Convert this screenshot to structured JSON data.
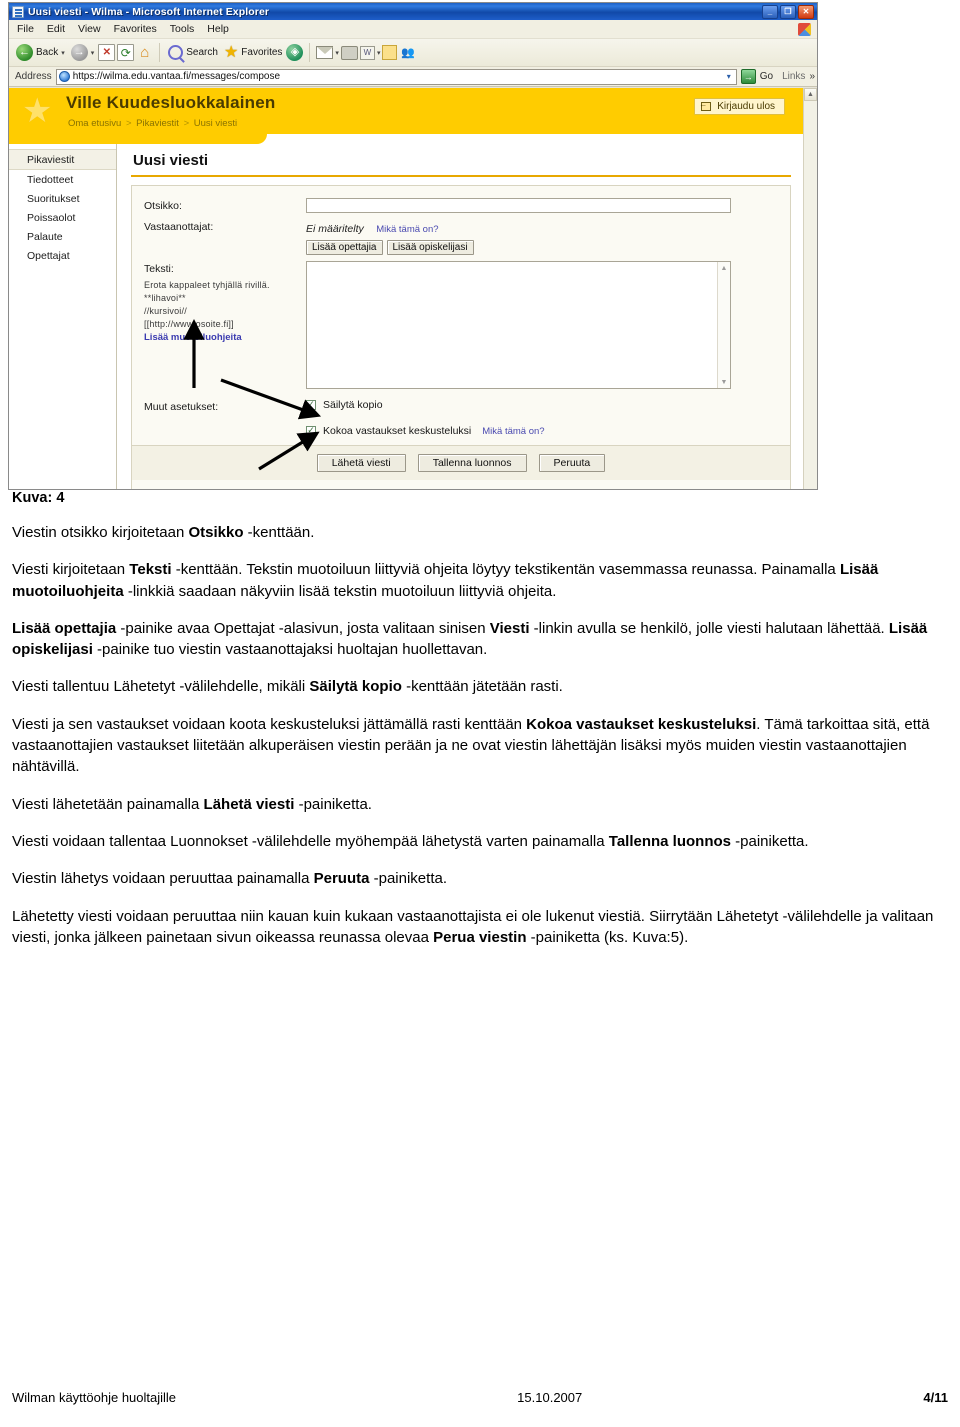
{
  "browser": {
    "title": "Uusi viesti - Wilma - Microsoft Internet Explorer",
    "window_buttons": {
      "minimize": "_",
      "maximize": "❐",
      "close": "✕"
    },
    "menu": [
      "File",
      "Edit",
      "View",
      "Favorites",
      "Tools",
      "Help"
    ],
    "toolbar": {
      "back_label": "Back",
      "back_caret": "▾",
      "forward_caret": "▾",
      "search_label": "Search",
      "favorites_label": "Favorites",
      "icons": [
        "back-arrow",
        "forward-arrow",
        "stop",
        "refresh",
        "home",
        "search",
        "favorites",
        "media",
        "mail",
        "print",
        "edit-word",
        "notes",
        "messenger"
      ]
    },
    "address": {
      "label": "Address",
      "url": "https://wilma.edu.vantaa.fi/messages/compose",
      "dropdown": "▾",
      "go_label": "Go",
      "links_label": "Links",
      "chevron": "»"
    }
  },
  "wilma": {
    "user_name": "Ville Kuudesluokkalainen",
    "breadcrumb": [
      "Oma etusivu",
      "Pikaviestit",
      "Uusi viesti"
    ],
    "breadcrumb_separator": ">",
    "logout_label": "Kirjaudu ulos",
    "sidebar": [
      {
        "label": "Pikaviestit",
        "active": true
      },
      {
        "label": "Tiedotteet",
        "active": false
      },
      {
        "label": "Suoritukset",
        "active": false
      },
      {
        "label": "Poissaolot",
        "active": false
      },
      {
        "label": "Palaute",
        "active": false
      },
      {
        "label": "Opettajat",
        "active": false
      }
    ],
    "page_title": "Uusi viesti",
    "form": {
      "subject_label": "Otsikko:",
      "subject_value": "",
      "recipients_label": "Vastaanottajat:",
      "recipients_value": "Ei määritelty",
      "recipients_help": "Mikä tämä on?",
      "add_teacher_button": "Lisää opettajia",
      "add_student_button": "Lisää opiskelijasi",
      "text_label": "Teksti:",
      "text_value": "",
      "format_hints": [
        "Erota kappaleet tyhjällä rivillä.",
        "**lihavoi**",
        "//kursivoi//",
        "[[http://www.osoite.fi]]"
      ],
      "format_more_link": "Lisää muotoiluohjeita",
      "other_settings_label": "Muut asetukset:",
      "keep_copy_label": "Säilytä kopio",
      "keep_copy_checked": true,
      "thread_label": "Kokoa vastaukset keskusteluksi",
      "thread_checked": true,
      "thread_help": "Mikä tämä on?",
      "send_button": "Lähetä viesti",
      "save_draft_button": "Tallenna luonnos",
      "cancel_button": "Peruuta"
    }
  },
  "document": {
    "caption": "Kuva: 4",
    "paragraphs": [
      [
        {
          "t": "Viestin otsikko kirjoitetaan ",
          "b": false
        },
        {
          "t": "Otsikko",
          "b": true
        },
        {
          "t": " -kenttään.",
          "b": false
        }
      ],
      [
        {
          "t": "Viesti kirjoitetaan ",
          "b": false
        },
        {
          "t": "Teksti",
          "b": true
        },
        {
          "t": " -kenttään. Tekstin muotoiluun liittyviä ohjeita löytyy tekstikentän vasemmassa reunassa. Painamalla ",
          "b": false
        },
        {
          "t": "Lisää muotoiluohjeita",
          "b": true
        },
        {
          "t": " -linkkiä saadaan näkyviin lisää tekstin muotoiluun liittyviä ohjeita.",
          "b": false
        }
      ],
      [
        {
          "t": "Lisää opettajia",
          "b": true
        },
        {
          "t": " -painike avaa Opettajat -alasivun, josta valitaan sinisen ",
          "b": false
        },
        {
          "t": "Viesti",
          "b": true
        },
        {
          "t": " -linkin avulla se henkilö, jolle viesti halutaan lähettää. ",
          "b": false
        },
        {
          "t": "Lisää opiskelijasi",
          "b": true
        },
        {
          "t": " -painike tuo viestin vastaanottajaksi huoltajan huollettavan.",
          "b": false
        }
      ],
      [
        {
          "t": "Viesti tallentuu Lähetetyt -välilehdelle, mikäli ",
          "b": false
        },
        {
          "t": "Säilytä kopio",
          "b": true
        },
        {
          "t": " -kenttään jätetään rasti.",
          "b": false
        }
      ],
      [
        {
          "t": "Viesti ja sen vastaukset voidaan koota keskusteluksi jättämällä rasti kenttään ",
          "b": false
        },
        {
          "t": "Kokoa vastaukset keskusteluksi",
          "b": true
        },
        {
          "t": ". Tämä tarkoittaa sitä, että vastaanottajien vastaukset liitetään alkuperäisen viestin perään ja ne ovat viestin lähettäjän lisäksi myös muiden viestin vastaanottajien nähtävillä.",
          "b": false
        }
      ],
      [
        {
          "t": "Viesti lähetetään painamalla ",
          "b": false
        },
        {
          "t": "Lähetä viesti",
          "b": true
        },
        {
          "t": " -painiketta.",
          "b": false
        }
      ],
      [
        {
          "t": "Viesti voidaan tallentaa Luonnokset -välilehdelle myöhempää lähetystä varten painamalla ",
          "b": false
        },
        {
          "t": "Tallenna luonnos",
          "b": true
        },
        {
          "t": " -painiketta.",
          "b": false
        }
      ],
      [
        {
          "t": "Viestin lähetys voidaan peruuttaa painamalla ",
          "b": false
        },
        {
          "t": "Peruuta",
          "b": true
        },
        {
          "t": " -painiketta.",
          "b": false
        }
      ],
      [
        {
          "t": "Lähetetty viesti voidaan peruuttaa niin kauan kuin kukaan vastaanottajista ei ole lukenut viestiä. Siirrytään Lähetetyt -välilehdelle ja valitaan viesti, jonka jälkeen painetaan sivun oikeassa reunassa olevaa ",
          "b": false
        },
        {
          "t": "Perua viestin",
          "b": true
        },
        {
          "t": " -painiketta (ks. Kuva:5).",
          "b": false
        }
      ]
    ]
  },
  "footer": {
    "left": "Wilman käyttöohje huoltajille",
    "center": "15.10.2007",
    "right": "4/11"
  },
  "colors": {
    "brand_yellow": "#ffcc00",
    "accent_rule": "#e8a800",
    "link_blue": "#4a4ab0",
    "titlebar_blue": "#1c5fc4"
  }
}
